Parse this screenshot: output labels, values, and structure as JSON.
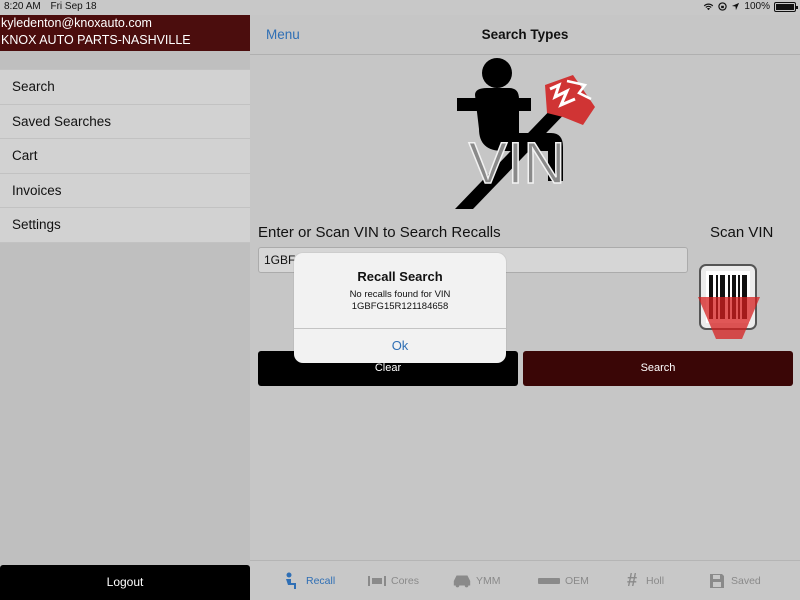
{
  "status_bar": {
    "time": "8:20 AM",
    "date": "Fri Sep 18",
    "battery": "100%"
  },
  "sidebar": {
    "account_email": "kyledenton@knoxauto.com",
    "store_name": "KNOX AUTO PARTS-NASHVILLE",
    "items": [
      {
        "label": "Search"
      },
      {
        "label": "Saved Searches"
      },
      {
        "label": "Cart"
      },
      {
        "label": "Invoices"
      },
      {
        "label": "Settings"
      }
    ],
    "logout_label": "Logout"
  },
  "nav": {
    "menu_label": "Menu",
    "title": "Search Types"
  },
  "logo": {
    "text": "VIN",
    "icon": "seatbelt-airbag-icon"
  },
  "form": {
    "vin_label": "Enter or Scan VIN to Search Recalls",
    "scan_label": "Scan VIN",
    "vin_value": "1GBFG15R121184658",
    "clear_label": "Clear",
    "search_label": "Search"
  },
  "dialog": {
    "title": "Recall Search",
    "message_line1": "No recalls found for VIN",
    "message_line2": "1GBFG15R121184658",
    "ok_label": "Ok"
  },
  "tabs": [
    {
      "label": "Recall",
      "icon": "recall-seat-icon",
      "active": true
    },
    {
      "label": "Cores",
      "icon": "cores-icon",
      "active": false
    },
    {
      "label": "YMM",
      "icon": "car-icon",
      "active": false
    },
    {
      "label": "OEM",
      "icon": "oem-number-icon",
      "active": false
    },
    {
      "label": "Holl",
      "icon": "hash-icon",
      "active": false
    },
    {
      "label": "Saved",
      "icon": "floppy-icon",
      "active": false
    }
  ],
  "colors": {
    "brand_dark_red": "#4b0d0d",
    "search_button": "#3a0606",
    "link_blue": "#2f6fb5",
    "clear_button": "#000000"
  }
}
